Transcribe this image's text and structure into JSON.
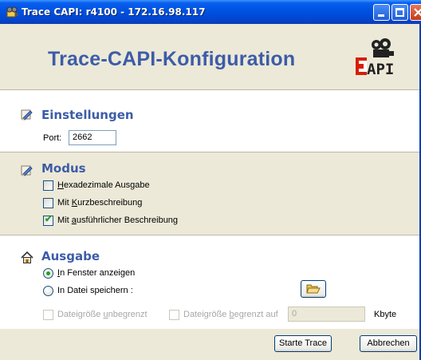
{
  "window": {
    "title": "Trace CAPI: r4100 - 172.16.98.117",
    "app_icon": "trace-app-icon",
    "controls": [
      "minimize-icon",
      "maximize-icon",
      "close-icon"
    ]
  },
  "header": {
    "title": "Trace-CAPI-Konfiguration",
    "logo_text": "CAPI",
    "logo_accent": "#D81E05"
  },
  "settings": {
    "title": "Einstellungen",
    "icon": "settings-pencil-icon",
    "port_label": "Port:",
    "port_value": "2662"
  },
  "mode": {
    "title": "Modus",
    "icon": "mode-pencil-icon",
    "hex_label_pre": "",
    "hex_label_key": "H",
    "hex_label_post": "exadezimale Ausgabe",
    "hex_checked": false,
    "short_label_pre": "Mit ",
    "short_label_key": "K",
    "short_label_post": "urzbeschreibung",
    "short_checked": false,
    "long_label_pre": "Mit ",
    "long_label_key": "a",
    "long_label_post": "usführlicher Beschreibung",
    "long_checked": true
  },
  "output": {
    "title": "Ausgabe",
    "icon": "home-icon",
    "window_label_key": "I",
    "window_label_post": "n Fenster anzeigen",
    "window_selected": true,
    "file_label": "In Datei speichern :",
    "file_selected": false,
    "browse_icon": "folder-open-icon",
    "unlimited_label_pre": "Dateigröße ",
    "unlimited_label_key": "u",
    "unlimited_label_post": "nbegrenzt",
    "limited_label_pre": "Dateigröße ",
    "limited_label_key": "b",
    "limited_label_post": "egrenzt auf",
    "limit_value": "0",
    "unit": "Kbyte"
  },
  "buttons": {
    "start": "Starte Trace",
    "cancel": "Abbrechen"
  },
  "colors": {
    "accent": "#3D5CA8",
    "titlebar": "#0054E3",
    "window_bg": "#ECE9D8"
  }
}
